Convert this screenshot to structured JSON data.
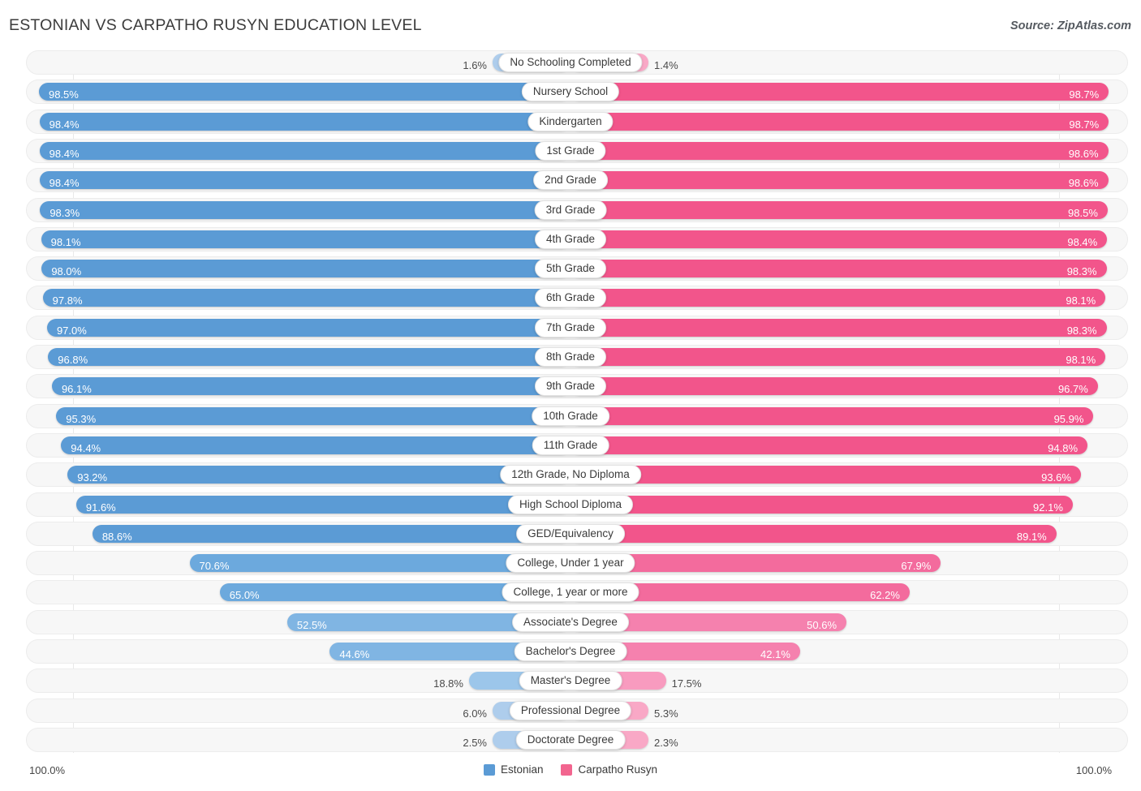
{
  "header": {
    "title": "ESTONIAN VS CARPATHO RUSYN EDUCATION LEVEL",
    "source": "Source: ZipAtlas.com"
  },
  "axis": {
    "left_end": "100.0%",
    "right_end": "100.0%"
  },
  "legend": [
    {
      "label": "Estonian",
      "color": "#5b9bd5"
    },
    {
      "label": "Carpatho Rusyn",
      "color": "#f2658f"
    }
  ],
  "chart_data": {
    "type": "bar",
    "orientation": "horizontal-diverging",
    "title": "ESTONIAN VS CARPATHO RUSYN EDUCATION LEVEL",
    "xlabel": "",
    "ylabel": "",
    "xlim": [
      0,
      100
    ],
    "grid": true,
    "legend_position": "bottom-center",
    "categories": [
      "No Schooling Completed",
      "Nursery School",
      "Kindergarten",
      "1st Grade",
      "2nd Grade",
      "3rd Grade",
      "4th Grade",
      "5th Grade",
      "6th Grade",
      "7th Grade",
      "8th Grade",
      "9th Grade",
      "10th Grade",
      "11th Grade",
      "12th Grade, No Diploma",
      "High School Diploma",
      "GED/Equivalency",
      "College, Under 1 year",
      "College, 1 year or more",
      "Associate's Degree",
      "Bachelor's Degree",
      "Master's Degree",
      "Professional Degree",
      "Doctorate Degree"
    ],
    "series": [
      {
        "name": "Estonian",
        "color": "#5b9bd5",
        "values": [
          1.6,
          98.5,
          98.4,
          98.4,
          98.4,
          98.3,
          98.1,
          98.0,
          97.8,
          97.0,
          96.8,
          96.1,
          95.3,
          94.4,
          93.2,
          91.6,
          88.6,
          70.6,
          65.0,
          52.5,
          44.6,
          18.8,
          6.0,
          2.5
        ],
        "labels": [
          "1.6%",
          "98.5%",
          "98.4%",
          "98.4%",
          "98.4%",
          "98.3%",
          "98.1%",
          "98.0%",
          "97.8%",
          "97.0%",
          "96.8%",
          "96.1%",
          "95.3%",
          "94.4%",
          "93.2%",
          "91.6%",
          "88.6%",
          "70.6%",
          "65.0%",
          "52.5%",
          "44.6%",
          "18.8%",
          "6.0%",
          "2.5%"
        ]
      },
      {
        "name": "Carpatho Rusyn",
        "color": "#f2658f",
        "values": [
          1.4,
          98.7,
          98.7,
          98.6,
          98.6,
          98.5,
          98.4,
          98.3,
          98.1,
          98.3,
          98.1,
          96.7,
          95.9,
          94.8,
          93.6,
          92.1,
          89.1,
          67.9,
          62.2,
          50.6,
          42.1,
          17.5,
          5.3,
          2.3
        ],
        "labels": [
          "1.4%",
          "98.7%",
          "98.7%",
          "98.6%",
          "98.6%",
          "98.5%",
          "98.4%",
          "98.3%",
          "98.1%",
          "98.3%",
          "98.1%",
          "96.7%",
          "95.9%",
          "94.8%",
          "93.6%",
          "92.1%",
          "89.1%",
          "67.9%",
          "62.2%",
          "50.6%",
          "42.1%",
          "17.5%",
          "5.3%",
          "2.3%"
        ]
      }
    ]
  }
}
